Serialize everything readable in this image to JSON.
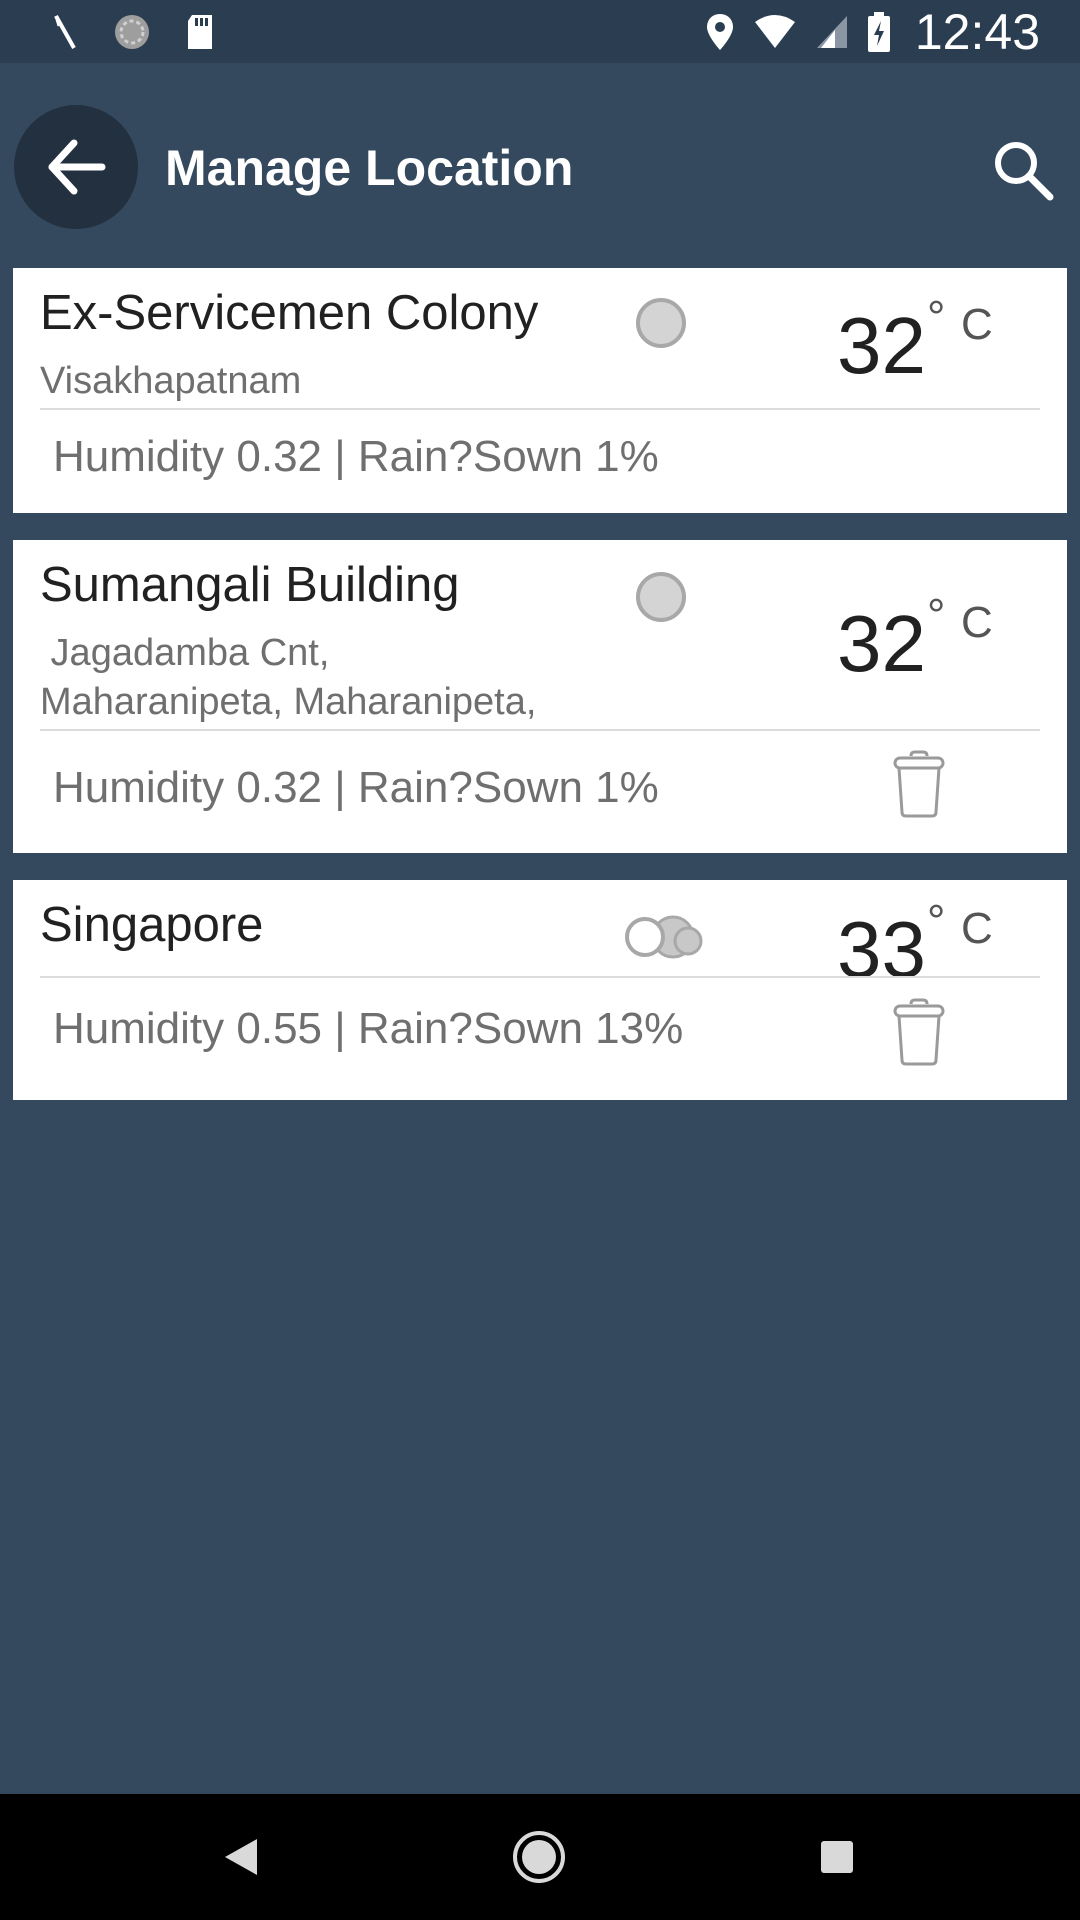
{
  "status_bar": {
    "time": "12:43",
    "left_icons": [
      "debug-icon",
      "sync-icon",
      "sd-card-icon"
    ],
    "right_icons": [
      "location-icon",
      "wifi-icon",
      "signal-icon",
      "battery-charging-icon"
    ]
  },
  "toolbar": {
    "title": "Manage Location",
    "back_icon": "arrow-back-icon",
    "search_icon": "search-icon"
  },
  "locations": [
    {
      "name": "Ex-Servicemen Colony",
      "address_lines": [
        "Visakhapatnam"
      ],
      "weather_icon": "clear-icon",
      "temperature": "32",
      "degree_symbol": "°",
      "unit": "C",
      "details": "Humidity 0.32 | Rain?Sown 1%",
      "deletable": false
    },
    {
      "name": "Sumangali Building",
      "address_lines": [
        " Jagadamba Cnt,",
        "Maharanipeta, Maharanipeta,"
      ],
      "weather_icon": "clear-icon",
      "temperature": "32",
      "degree_symbol": "°",
      "unit": "C",
      "details": "Humidity 0.32 | Rain?Sown 1%",
      "deletable": true
    },
    {
      "name": "Singapore",
      "address_lines": [],
      "weather_icon": "cloudy-icon",
      "temperature": "33",
      "degree_symbol": "°",
      "unit": "C",
      "details": "Humidity 0.55 | Rain?Sown 13%",
      "deletable": true
    }
  ],
  "nav_bar": {
    "buttons": [
      "back-triangle-icon",
      "home-circle-icon",
      "recents-square-icon"
    ]
  },
  "colors": {
    "background": "#34495e",
    "status_bar": "#2b3d50",
    "card": "#ffffff",
    "primary_text": "#212121",
    "secondary_text": "#6f6f6f"
  }
}
